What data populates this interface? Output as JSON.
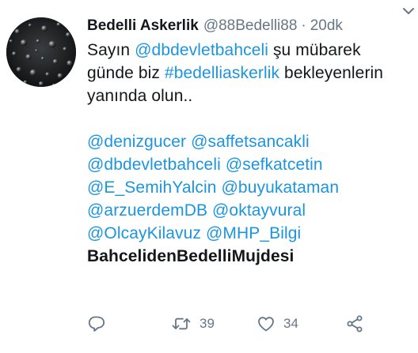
{
  "tweet": {
    "author_name": "Bedelli Askerlik",
    "handle": "@88Bedelli88",
    "separator": "·",
    "time": "20dk",
    "line1_prefix": "Sayın ",
    "line1_mention": "@dbdevletbahceli",
    "line1_suffix": " şu mübarek",
    "line2_prefix": "günde biz ",
    "line2_hashtag": "#bedelliaskerlik",
    "line2_suffix": " bekleyenlerin",
    "line3": "yanında olun..",
    "mention_rows": [
      [
        "@denizgucer",
        "@saffetsancakli"
      ],
      [
        "@dbdevletbahceli",
        "@sefkatcetin"
      ],
      [
        "@E_SemihYalcin",
        "@buyukataman"
      ],
      [
        "@arzuerdemDB",
        "@oktayvural"
      ],
      [
        "@OlcayKilavuz",
        "@MHP_Bilgi"
      ]
    ],
    "bold_line": "BahcelidenBedelliMujdesi"
  },
  "actions": {
    "retweet_count": "39",
    "like_count": "34"
  },
  "icons": {
    "reply": "reply-icon",
    "retweet": "retweet-icon",
    "like": "heart-icon",
    "share": "share-icon",
    "more": "chevron-down-icon"
  },
  "colors": {
    "link": "#1b95e0",
    "muted": "#657786",
    "text": "#14171a"
  }
}
